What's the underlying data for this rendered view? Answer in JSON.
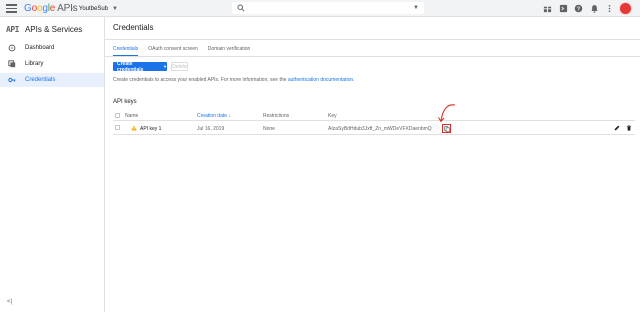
{
  "topbar": {
    "logo_google": [
      "G",
      "o",
      "o",
      "g",
      "l",
      "e"
    ],
    "logo_apis": "APIs",
    "project_name": "YoutbeSub",
    "search_placeholder": "",
    "avatar_initials": ""
  },
  "sidebar": {
    "api_mark": "API",
    "title": "APIs & Services",
    "items": [
      {
        "label": "Dashboard",
        "icon": "dashboard-icon"
      },
      {
        "label": "Library",
        "icon": "library-icon"
      },
      {
        "label": "Credentials",
        "icon": "key-icon",
        "active": true
      }
    ],
    "collapse_label": "<|"
  },
  "main": {
    "title": "Credentials",
    "tabs": [
      {
        "label": "Credentials",
        "active": true
      },
      {
        "label": "OAuth consent screen"
      },
      {
        "label": "Domain verification"
      }
    ],
    "create_button": "Create credentials",
    "delete_button": "Delete",
    "help_text": "Create credentials to access your enabled APIs. For more information, see the",
    "help_link": "authentication documentation.",
    "section_title": "API keys",
    "table": {
      "headers": {
        "name": "Name",
        "creation_date": "Creation date",
        "sort_arrow": "↓",
        "restrictions": "Restrictions",
        "key": "Key"
      },
      "rows": [
        {
          "name": "API key 1",
          "creation_date": "Jul 16, 2019",
          "restrictions": "None",
          "key": "AIzaSyBdHdub3Jxft_Zn_mWDeVFXDaenbmQ"
        }
      ]
    }
  },
  "colors": {
    "accent": "#1a73e8",
    "warning": "#f9ab00",
    "annotation": "#d93025"
  }
}
